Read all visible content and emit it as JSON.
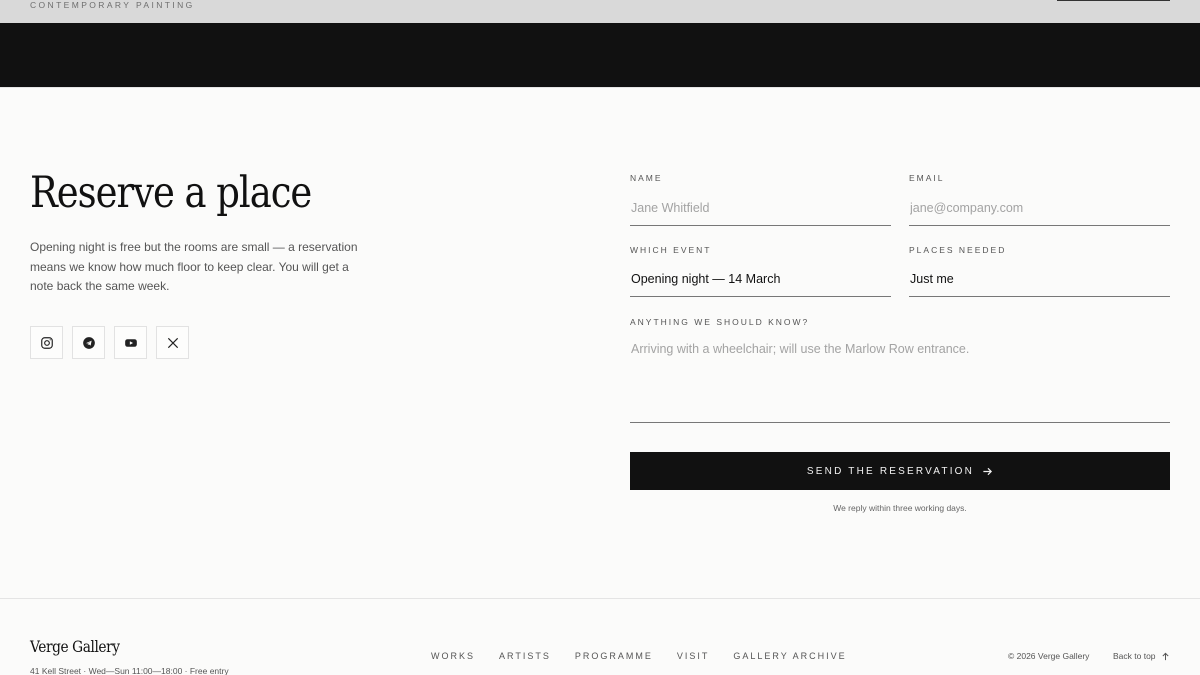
{
  "header": {
    "brand_tagline": "CONTEMPORARY PAINTING"
  },
  "reserve": {
    "title": "Reserve a place",
    "description": "Opening night is free but the rooms are small — a reservation means we know how much floor to keep clear. You will get a note back the same week.",
    "socials": [
      {
        "icon": "instagram-icon"
      },
      {
        "icon": "telegram-icon"
      },
      {
        "icon": "youtube-icon"
      },
      {
        "icon": "x-icon"
      }
    ]
  },
  "form": {
    "name_label": "NAME",
    "name_placeholder": "Jane Whitfield",
    "email_label": "EMAIL",
    "email_placeholder": "jane@company.com",
    "event_label": "WHICH EVENT",
    "event_value": "Opening night — 14 March",
    "places_label": "PLACES NEEDED",
    "places_value": "Just me",
    "notes_label": "ANYTHING WE SHOULD KNOW?",
    "notes_placeholder": "Arriving with a wheelchair; will use the Marlow Row entrance.",
    "submit_label": "SEND THE RESERVATION",
    "reply_note": "We reply within three working days."
  },
  "footer": {
    "brand": "Verge Gallery",
    "address": "41 Kell Street · Wed—Sun 11:00—18:00 · Free entry",
    "nav": [
      "WORKS",
      "ARTISTS",
      "PROGRAMME",
      "VISIT",
      "GALLERY ARCHIVE"
    ],
    "copyright": "© 2026 Verge Gallery",
    "back_to_top": "Back to top"
  }
}
